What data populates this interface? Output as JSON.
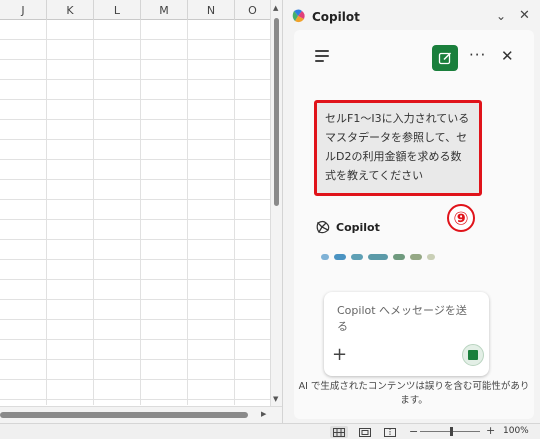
{
  "sheet": {
    "columns": [
      "J",
      "K",
      "L",
      "M",
      "N",
      "O"
    ]
  },
  "copilot_pane": {
    "title": "Copilot",
    "user_message": "セルF1〜I3に入力されているマスタデータを参照して、セルD2の利用金額を求める数式を教えてください",
    "callout_number": "⑨",
    "response_label": "Copilot",
    "input_placeholder": "Copilot へメッセージを送る",
    "disclaimer": "AI で生成されたコンテンツは誤りを含む可能性があります。",
    "loading_dot_colors": [
      "#7fb2d6",
      "#4a93c2",
      "#5fa0b5",
      "#5b9aa8",
      "#6f9a7e",
      "#95a885",
      "#c9cfb6"
    ]
  },
  "status_bar": {
    "zoom_minus": "−",
    "zoom_plus": "+",
    "zoom_level": "100%",
    "zoom_percent": 100
  }
}
